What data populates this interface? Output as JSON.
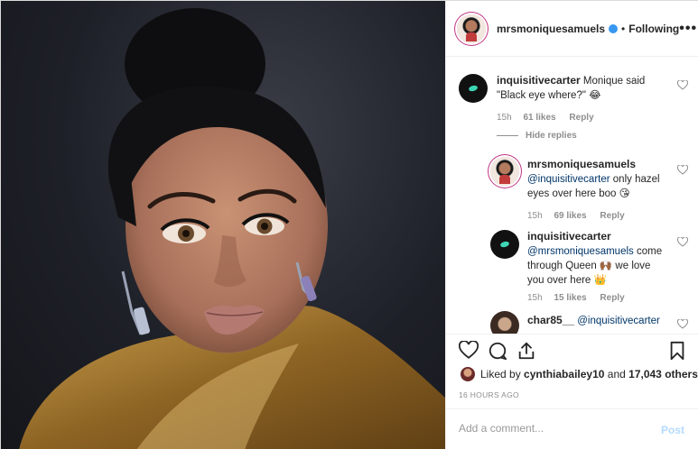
{
  "post": {
    "username": "mrsmoniquesamuels",
    "dot": "•",
    "following_label": "Following",
    "more_label": "•••"
  },
  "comments": [
    {
      "username": "inquisitivecarter",
      "text": "Monique said \"Black eye where?\" 😂",
      "time": "15h",
      "likes": "61 likes",
      "reply": "Reply",
      "hide_replies": "Hide replies"
    },
    {
      "username": "mrsmoniquesamuels",
      "mention": "@inquisitivecarter",
      "text": " only hazel eyes over here boo 😘",
      "time": "15h",
      "likes": "69 likes",
      "reply": "Reply"
    },
    {
      "username": "inquisitivecarter",
      "mention": "@mrsmoniquesamuels",
      "text": " come through Queen 🙌🏾 we love you over here 👑",
      "time": "15h",
      "likes": "15 likes",
      "reply": "Reply"
    },
    {
      "username": "char85__",
      "mention": "@inquisitivecarter"
    }
  ],
  "likes": {
    "prefix": "Liked by",
    "user": "cynthiabailey10",
    "and": "and",
    "count": "17,043 others"
  },
  "timestamp": "16 HOURS AGO",
  "add_comment": {
    "placeholder": "Add a comment...",
    "post_label": "Post"
  },
  "colors": {
    "ring": "#c13584",
    "verified": "#3897f0",
    "mention": "#003569",
    "post_disabled": "#b3dbff",
    "jacket": "#a8782e"
  },
  "icons": [
    "heart-icon",
    "comment-icon",
    "share-icon",
    "bookmark-icon",
    "small-heart-icon",
    "verified-badge-icon"
  ]
}
